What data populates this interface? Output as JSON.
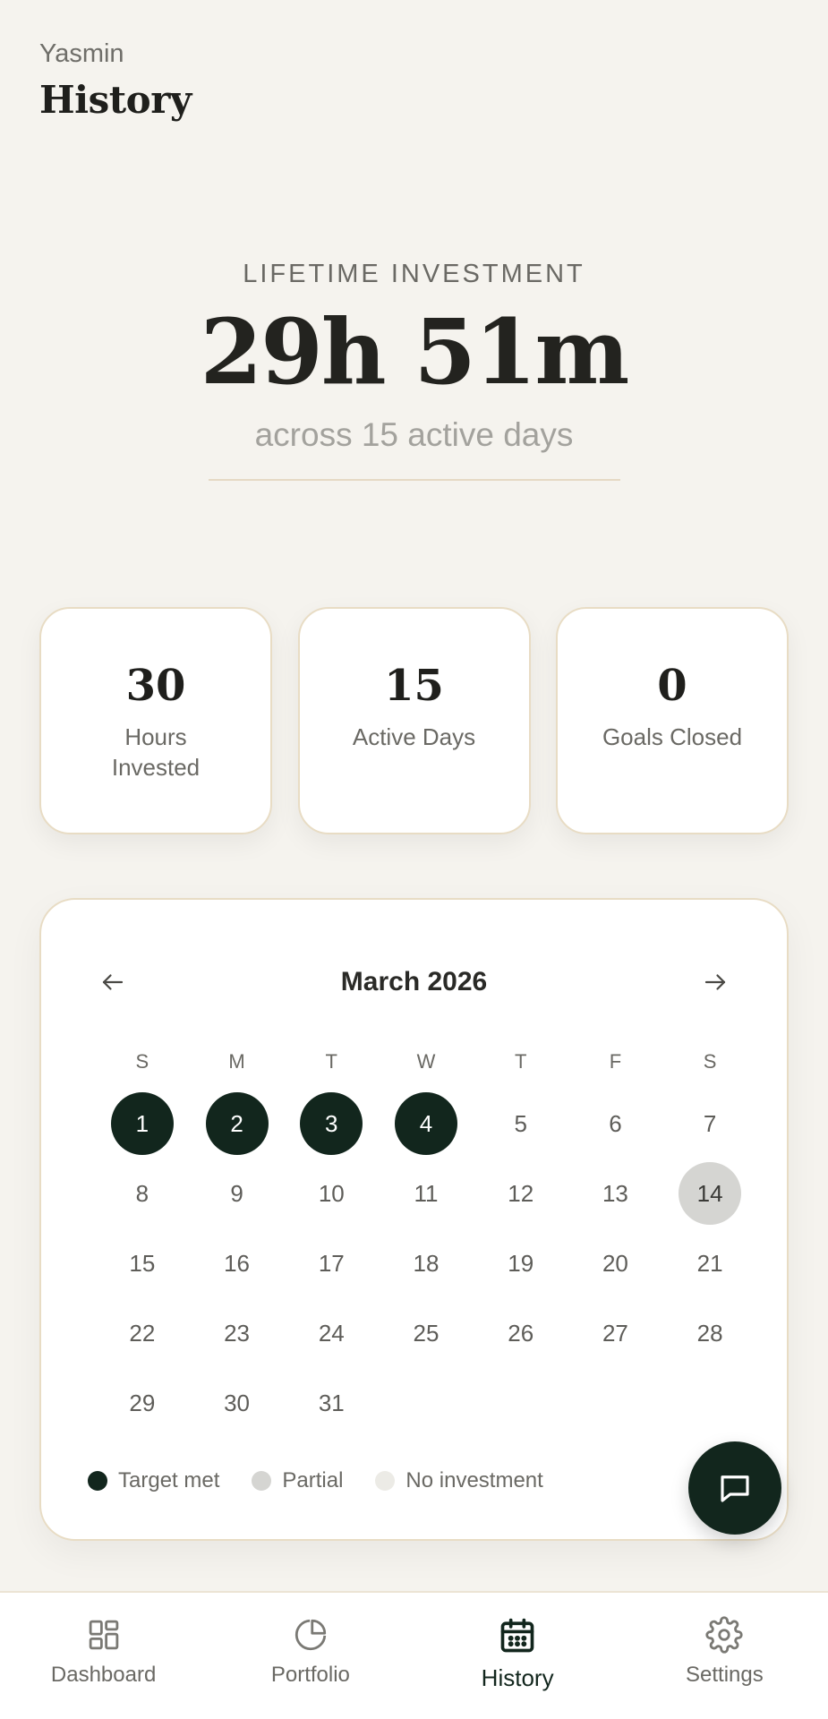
{
  "header": {
    "user": "Yasmin",
    "title": "History"
  },
  "hero": {
    "label": "LIFETIME INVESTMENT",
    "value": "29h 51m",
    "subtitle": "across 15 active days"
  },
  "stats": [
    {
      "value": "30",
      "label": "Hours Invested"
    },
    {
      "value": "15",
      "label": "Active Days"
    },
    {
      "value": "0",
      "label": "Goals Closed"
    }
  ],
  "calendar": {
    "month": "March 2026",
    "weekdays": [
      "S",
      "M",
      "T",
      "W",
      "T",
      "F",
      "S"
    ],
    "days": [
      {
        "n": "1",
        "s": "met"
      },
      {
        "n": "2",
        "s": "met"
      },
      {
        "n": "3",
        "s": "met"
      },
      {
        "n": "4",
        "s": "met"
      },
      {
        "n": "5",
        "s": ""
      },
      {
        "n": "6",
        "s": ""
      },
      {
        "n": "7",
        "s": ""
      },
      {
        "n": "8",
        "s": ""
      },
      {
        "n": "9",
        "s": ""
      },
      {
        "n": "10",
        "s": ""
      },
      {
        "n": "11",
        "s": ""
      },
      {
        "n": "12",
        "s": ""
      },
      {
        "n": "13",
        "s": ""
      },
      {
        "n": "14",
        "s": "partial"
      },
      {
        "n": "15",
        "s": ""
      },
      {
        "n": "16",
        "s": ""
      },
      {
        "n": "17",
        "s": ""
      },
      {
        "n": "18",
        "s": ""
      },
      {
        "n": "19",
        "s": ""
      },
      {
        "n": "20",
        "s": ""
      },
      {
        "n": "21",
        "s": ""
      },
      {
        "n": "22",
        "s": ""
      },
      {
        "n": "23",
        "s": ""
      },
      {
        "n": "24",
        "s": ""
      },
      {
        "n": "25",
        "s": ""
      },
      {
        "n": "26",
        "s": ""
      },
      {
        "n": "27",
        "s": ""
      },
      {
        "n": "28",
        "s": ""
      },
      {
        "n": "29",
        "s": ""
      },
      {
        "n": "30",
        "s": ""
      },
      {
        "n": "31",
        "s": ""
      }
    ],
    "legend": [
      {
        "label": "Target met",
        "color": "#12261d"
      },
      {
        "label": "Partial",
        "color": "#d5d5d2"
      },
      {
        "label": "No investment",
        "color": "#ecebe6"
      }
    ]
  },
  "nav": {
    "items": [
      {
        "label": "Dashboard",
        "icon": "grid-icon"
      },
      {
        "label": "Portfolio",
        "icon": "pie-chart-icon"
      },
      {
        "label": "History",
        "icon": "calendar-icon",
        "active": true
      },
      {
        "label": "Settings",
        "icon": "gear-icon"
      }
    ]
  },
  "colors": {
    "accent": "#12261d",
    "background": "#f5f3ee",
    "card_border": "#e8dcc4"
  }
}
